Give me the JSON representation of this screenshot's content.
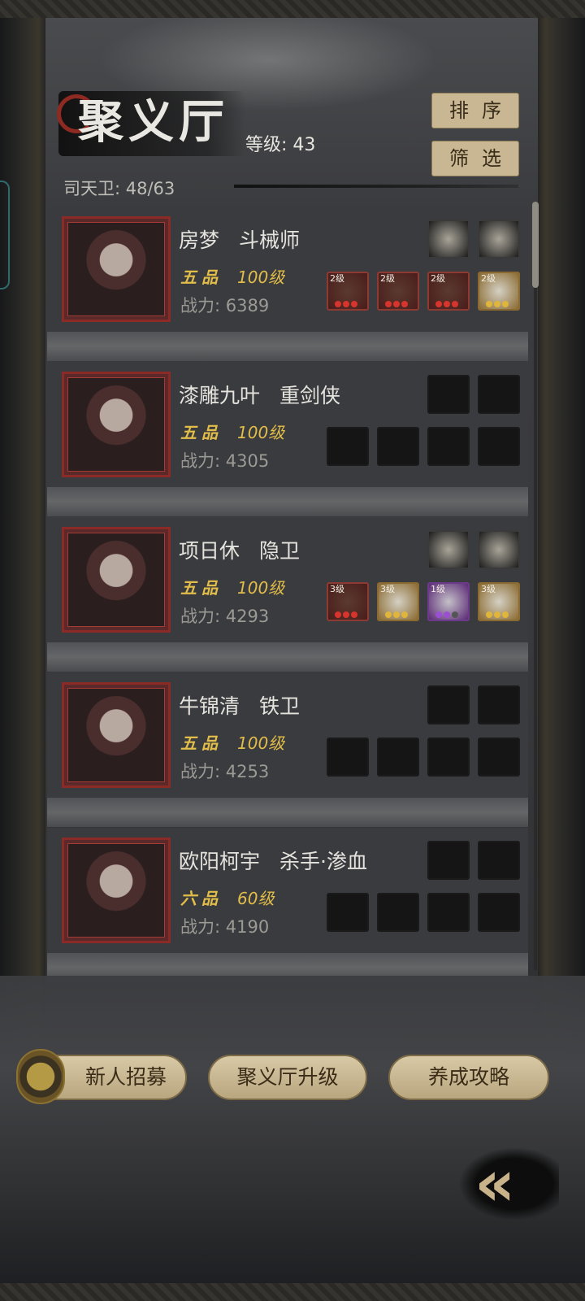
{
  "header": {
    "title": "聚义厅",
    "level_label": "等级: 43",
    "sort_label": "排序",
    "filter_label": "筛选",
    "guard_count": "司天卫: 48/63"
  },
  "heroes": [
    {
      "name": "房梦",
      "class": "斗械师",
      "rank": "五品",
      "level": "100级",
      "power": "战力: 6389",
      "slots_top": [
        {
          "type": "dark"
        },
        {
          "type": "dark"
        }
      ],
      "slots_bottom": [
        {
          "type": "red",
          "lv": "2级"
        },
        {
          "type": "red",
          "lv": "2级"
        },
        {
          "type": "red",
          "lv": "2级"
        },
        {
          "type": "gold",
          "lv": "2级"
        }
      ]
    },
    {
      "name": "漆雕九叶",
      "class": "重剑侠",
      "rank": "五品",
      "level": "100级",
      "power": "战力: 4305",
      "slots_top": [
        {
          "type": "empty"
        },
        {
          "type": "empty"
        }
      ],
      "slots_bottom": [
        {
          "type": "empty"
        },
        {
          "type": "empty"
        },
        {
          "type": "empty"
        },
        {
          "type": "empty"
        }
      ]
    },
    {
      "name": "项日休",
      "class": "隐卫",
      "rank": "五品",
      "level": "100级",
      "power": "战力: 4293",
      "slots_top": [
        {
          "type": "dark"
        },
        {
          "type": "dark"
        }
      ],
      "slots_bottom": [
        {
          "type": "red",
          "lv": "3级"
        },
        {
          "type": "gold",
          "lv": "3级"
        },
        {
          "type": "purple",
          "lv": "1级"
        },
        {
          "type": "gold",
          "lv": "3级"
        }
      ]
    },
    {
      "name": "牛锦清",
      "class": "铁卫",
      "rank": "五品",
      "level": "100级",
      "power": "战力: 4253",
      "slots_top": [
        {
          "type": "empty"
        },
        {
          "type": "empty"
        }
      ],
      "slots_bottom": [
        {
          "type": "empty"
        },
        {
          "type": "empty"
        },
        {
          "type": "empty"
        },
        {
          "type": "empty"
        }
      ]
    },
    {
      "name": "欧阳柯宇",
      "class": "杀手·渗血",
      "rank": "六品",
      "level": "60级",
      "power": "战力: 4190",
      "slots_top": [
        {
          "type": "empty"
        },
        {
          "type": "empty"
        }
      ],
      "slots_bottom": [
        {
          "type": "empty"
        },
        {
          "type": "empty"
        },
        {
          "type": "empty"
        },
        {
          "type": "empty"
        }
      ]
    }
  ],
  "footer": {
    "recruit_label": "新人招募",
    "upgrade_label": "聚义厅升级",
    "guide_label": "养成攻略",
    "back_icon": "double-chevron-left-icon",
    "back_label": "«"
  },
  "colors": {
    "rank_gold": "#e2bd4a",
    "button_beige": "#c8b792",
    "portrait_frame_red": "#8b2a26",
    "background": "#38393c"
  }
}
